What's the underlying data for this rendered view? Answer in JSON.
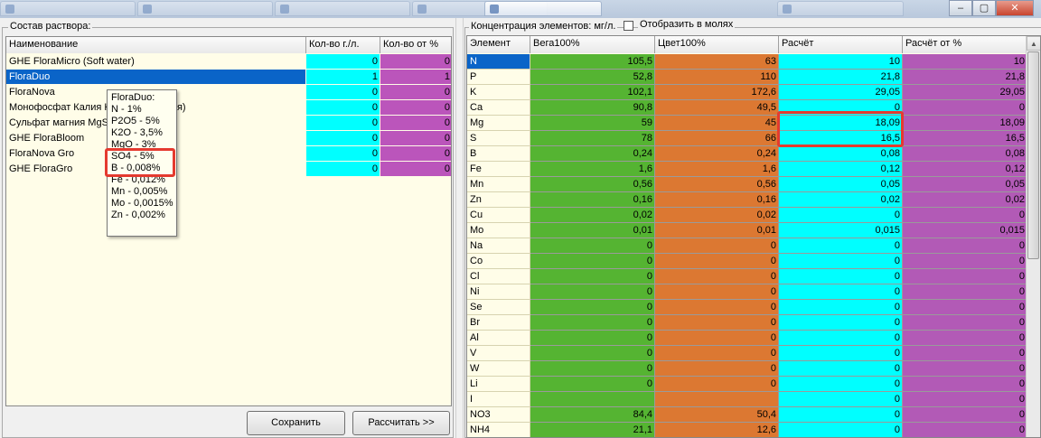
{
  "taskbar": {
    "tabs": [
      "",
      "",
      "",
      "",
      "",
      ""
    ],
    "window_buttons": {
      "minimize": "–",
      "maximize": "▢",
      "close": "✕"
    }
  },
  "left_panel": {
    "group_title": "Состав раствора:",
    "columns": [
      "Наименование",
      "Кол-во г./л.",
      "Кол-во от %"
    ],
    "rows": [
      {
        "name": "GHE FloraMicro (Soft water)",
        "qty": "0",
        "pct": "0"
      },
      {
        "name": "FloraDuo",
        "qty": "1",
        "pct": "1",
        "selected": true
      },
      {
        "name": "FloraNova",
        "qty": "0",
        "pct": "0"
      },
      {
        "name": "Монофосфат Калия KH2PO4 (не уд-я)",
        "qty": "0",
        "pct": "0"
      },
      {
        "name": "Сульфат магния MgSO4",
        "qty": "0",
        "pct": "0"
      },
      {
        "name": "GHE FloraBloom",
        "qty": "0",
        "pct": "0"
      },
      {
        "name": "FloraNova Gro",
        "qty": "0",
        "pct": "0"
      },
      {
        "name": "GHE FloraGro",
        "qty": "0",
        "pct": "0"
      }
    ],
    "save_button": "Сохранить",
    "calc_button": "Рассчитать >>"
  },
  "tooltip": {
    "title": "FloraDuo:",
    "lines": [
      "N - 1%",
      "P2O5 - 5%",
      "K2O - 3,5%",
      "MgO - 3%",
      "SO4 - 5%",
      "B - 0,008%",
      "Fe - 0,012%",
      "Mn - 0,005%",
      "Mo - 0,0015%",
      "Zn - 0,002%"
    ]
  },
  "right_panel": {
    "group_title": "Концентрация элементов: мг/л.",
    "checkbox_label": "Отобразить в молях",
    "columns": [
      "Элемент",
      "Вега100%",
      "Цвет100%",
      "Расчёт",
      "Расчёт от %"
    ],
    "rows": [
      {
        "el": "N",
        "v1": "105,5",
        "v2": "63",
        "calc": "10",
        "calcp": "10",
        "selected": true
      },
      {
        "el": "P",
        "v1": "52,8",
        "v2": "110",
        "calc": "21,8",
        "calcp": "21,8"
      },
      {
        "el": "K",
        "v1": "102,1",
        "v2": "172,6",
        "calc": "29,05",
        "calcp": "29,05"
      },
      {
        "el": "Ca",
        "v1": "90,8",
        "v2": "49,5",
        "calc": "0",
        "calcp": "0"
      },
      {
        "el": "Mg",
        "v1": "59",
        "v2": "45",
        "calc": "18,09",
        "calcp": "18,09"
      },
      {
        "el": "S",
        "v1": "78",
        "v2": "66",
        "calc": "16,5",
        "calcp": "16,5"
      },
      {
        "el": "B",
        "v1": "0,24",
        "v2": "0,24",
        "calc": "0,08",
        "calcp": "0,08"
      },
      {
        "el": "Fe",
        "v1": "1,6",
        "v2": "1,6",
        "calc": "0,12",
        "calcp": "0,12"
      },
      {
        "el": "Mn",
        "v1": "0,56",
        "v2": "0,56",
        "calc": "0,05",
        "calcp": "0,05"
      },
      {
        "el": "Zn",
        "v1": "0,16",
        "v2": "0,16",
        "calc": "0,02",
        "calcp": "0,02"
      },
      {
        "el": "Cu",
        "v1": "0,02",
        "v2": "0,02",
        "calc": "0",
        "calcp": "0"
      },
      {
        "el": "Mo",
        "v1": "0,01",
        "v2": "0,01",
        "calc": "0,015",
        "calcp": "0,015"
      },
      {
        "el": "Na",
        "v1": "0",
        "v2": "0",
        "calc": "0",
        "calcp": "0"
      },
      {
        "el": "Co",
        "v1": "0",
        "v2": "0",
        "calc": "0",
        "calcp": "0"
      },
      {
        "el": "Cl",
        "v1": "0",
        "v2": "0",
        "calc": "0",
        "calcp": "0"
      },
      {
        "el": "Ni",
        "v1": "0",
        "v2": "0",
        "calc": "0",
        "calcp": "0"
      },
      {
        "el": "Se",
        "v1": "0",
        "v2": "0",
        "calc": "0",
        "calcp": "0"
      },
      {
        "el": "Br",
        "v1": "0",
        "v2": "0",
        "calc": "0",
        "calcp": "0"
      },
      {
        "el": "Al",
        "v1": "0",
        "v2": "0",
        "calc": "0",
        "calcp": "0"
      },
      {
        "el": "V",
        "v1": "0",
        "v2": "0",
        "calc": "0",
        "calcp": "0"
      },
      {
        "el": "W",
        "v1": "0",
        "v2": "0",
        "calc": "0",
        "calcp": "0"
      },
      {
        "el": "Li",
        "v1": "0",
        "v2": "0",
        "calc": "0",
        "calcp": "0"
      },
      {
        "el": "I",
        "v1": "",
        "v2": "",
        "calc": "0",
        "calcp": "0"
      },
      {
        "el": "NO3",
        "v1": "84,4",
        "v2": "50,4",
        "calc": "0",
        "calcp": "0"
      },
      {
        "el": "NH4",
        "v1": "21,1",
        "v2": "12,6",
        "calc": "0",
        "calcp": "0"
      }
    ]
  },
  "colors": {
    "qty_col": "#00ffff",
    "pct_col": "#bb55bb",
    "vega_col": "#55b432",
    "color_col": "#dc7832",
    "calc_col": "#00ffff",
    "calcp_col": "#b25ab6",
    "highlight": "#e53a2f",
    "selection": "#0a64c8"
  }
}
